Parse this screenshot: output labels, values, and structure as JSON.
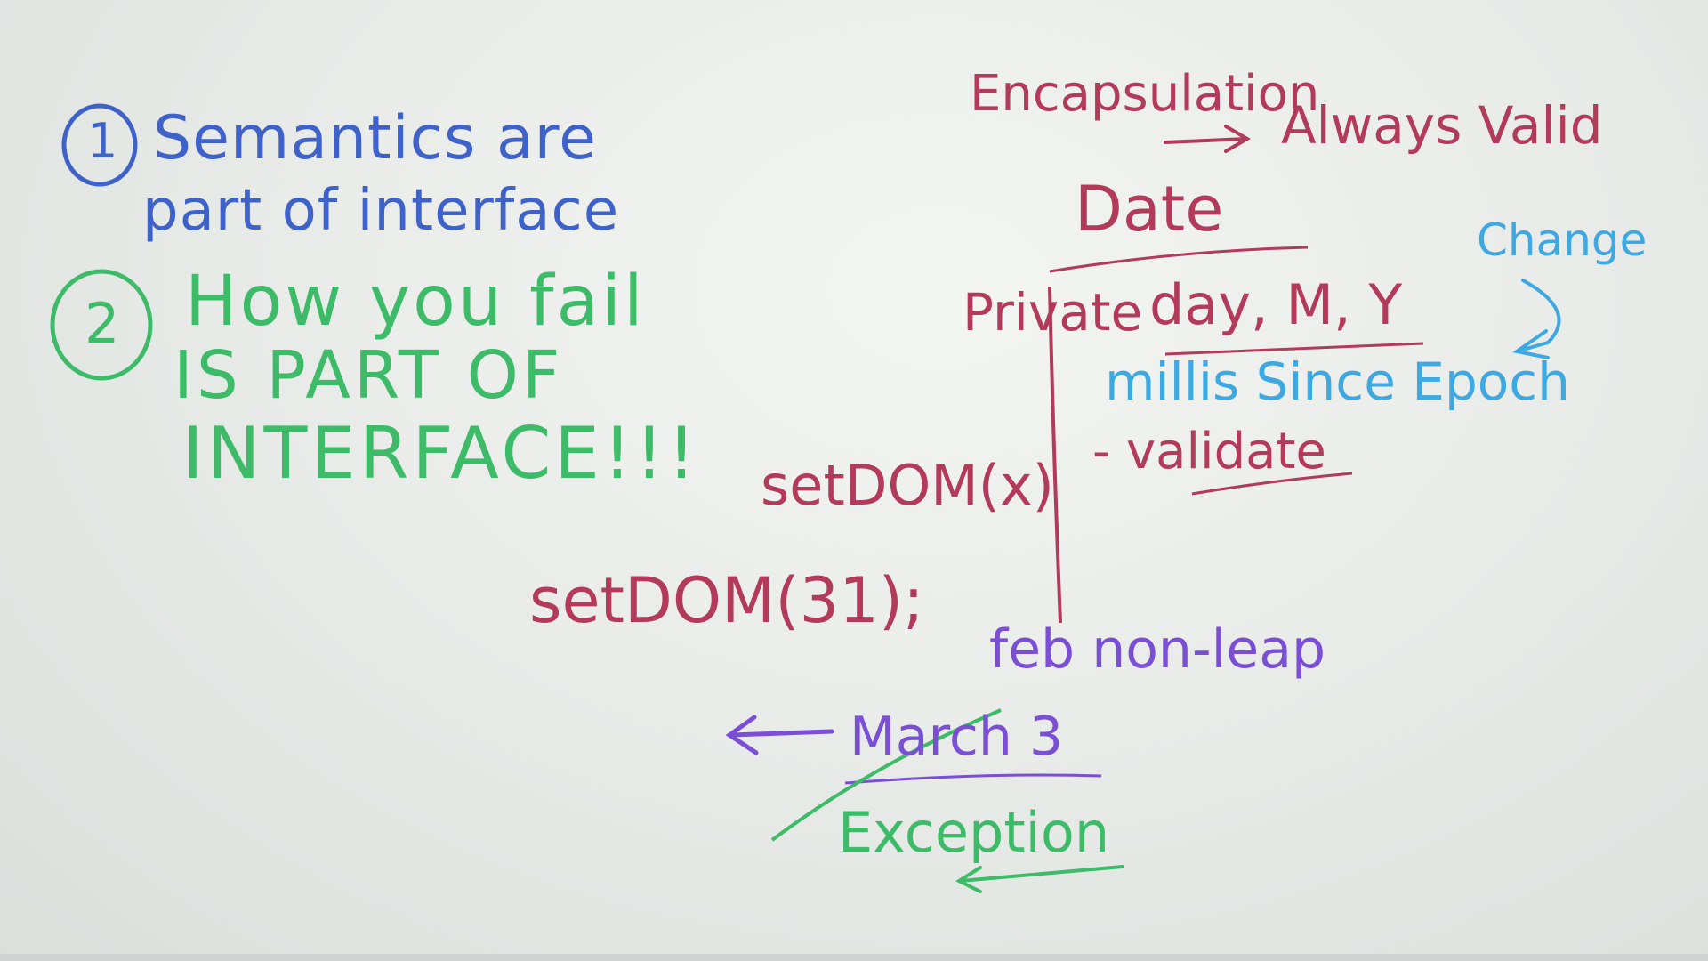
{
  "colors": {
    "blue": "#3f62c8",
    "green": "#3dbb69",
    "red": "#b23a5a",
    "purple": "#7a4fd6",
    "lightblue": "#3ea8e0"
  },
  "left": {
    "point1": {
      "marker": "1",
      "line1": "Semantics are",
      "line2": "part of interface"
    },
    "point2": {
      "marker": "2",
      "line1": "How you fail",
      "line2": "IS PART OF",
      "line3": "INTERFACE!!!"
    }
  },
  "right": {
    "encapsulation": "Encapsulation",
    "always_valid": "Always Valid",
    "date": "Date",
    "change": "Change",
    "private": "Private",
    "fields": "day, M, Y",
    "millis": "millis Since Epoch",
    "validate": "- validate",
    "set_dom_x": "setDOM(x)",
    "set_dom_31": "setDOM(31);",
    "feb": "feb non-leap",
    "march": "March 3",
    "exception": "Exception"
  }
}
